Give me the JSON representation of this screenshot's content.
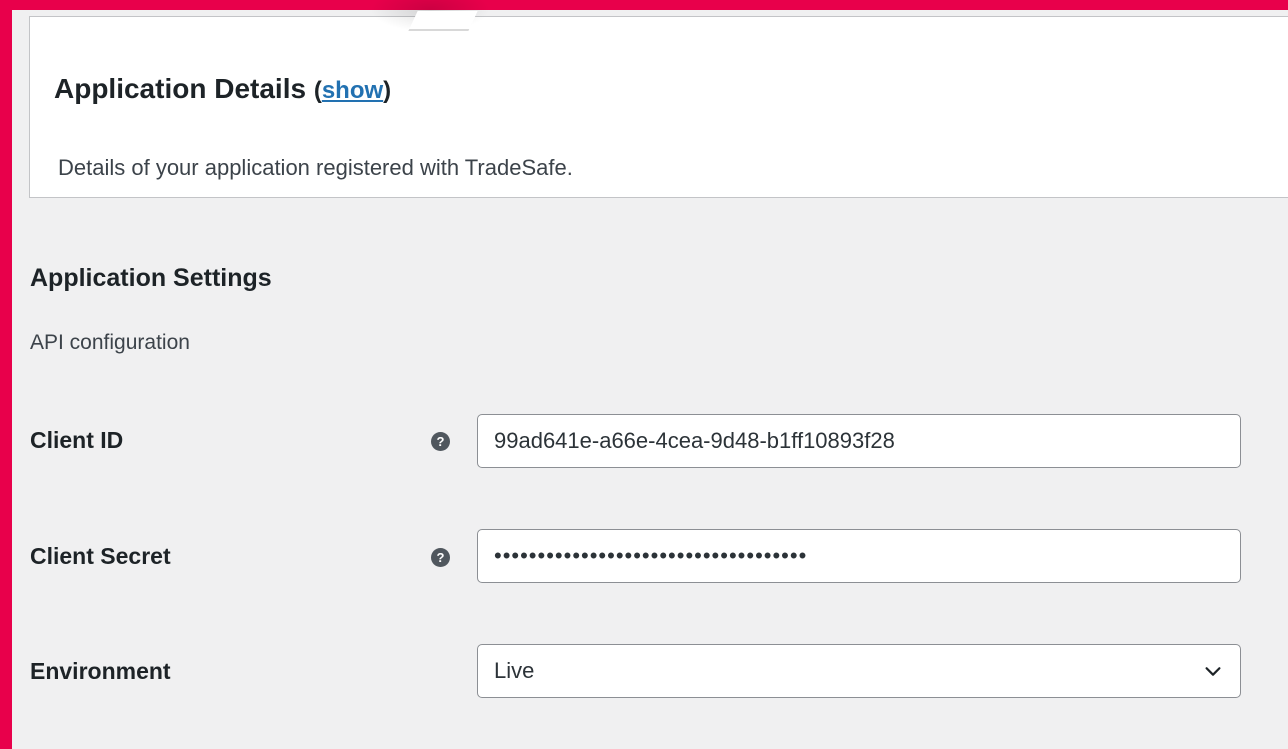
{
  "details_card": {
    "title": "Application Details",
    "toggle_open": "(",
    "toggle_link": "show",
    "toggle_close": ")",
    "description": "Details of your application registered with TradeSafe."
  },
  "settings": {
    "title": "Application Settings",
    "description": "API configuration",
    "fields": {
      "client_id": {
        "label": "Client ID",
        "value": "99ad641e-a66e-4cea-9d48-b1ff10893f28",
        "help_icon": "question-circle-icon"
      },
      "client_secret": {
        "label": "Client Secret",
        "value": "••••••••••••••••••••••••••••••••••••",
        "help_icon": "question-circle-icon"
      },
      "environment": {
        "label": "Environment",
        "selected": "Live",
        "icon": "chevron-down-icon"
      }
    }
  },
  "colors": {
    "border_accent": "#e8004b",
    "link": "#2271b1",
    "page_bg": "#f0f0f1"
  }
}
